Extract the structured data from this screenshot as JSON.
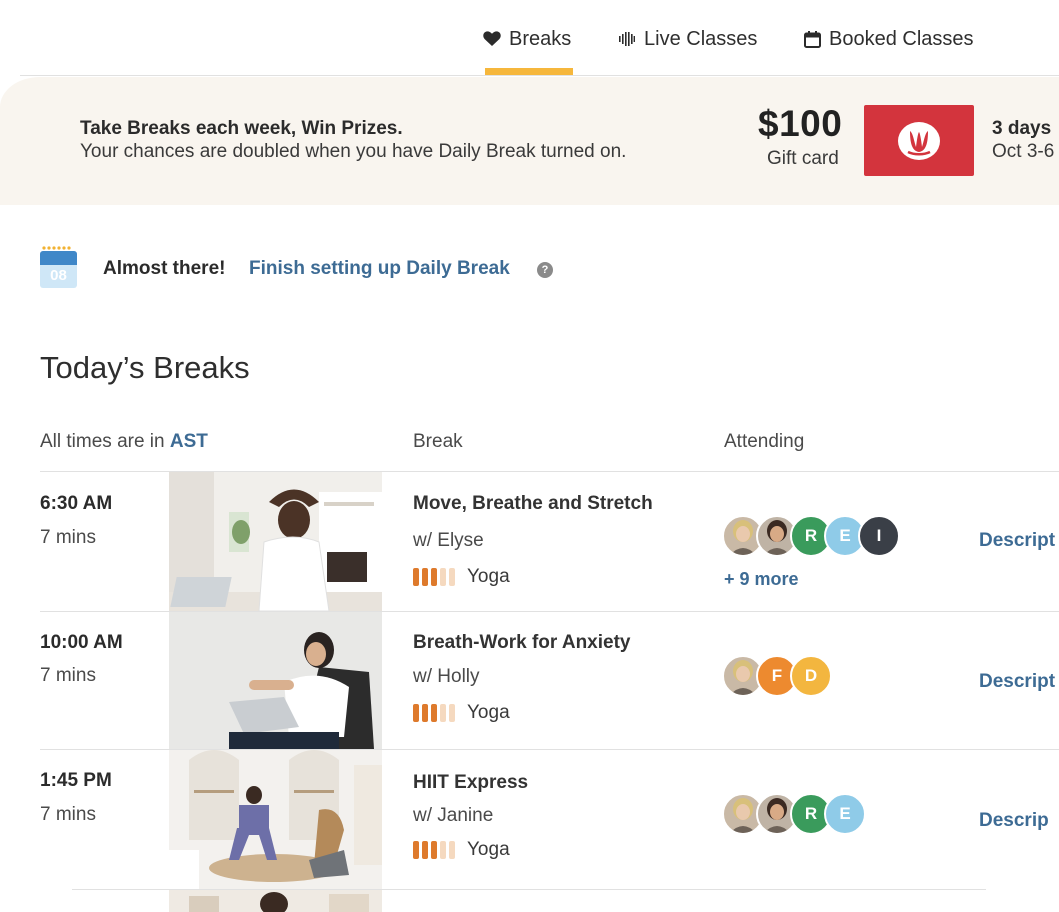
{
  "tabs": [
    {
      "label": "Breaks",
      "icon": "heart-icon",
      "active": true
    },
    {
      "label": "Live Classes",
      "icon": "live-bars-icon",
      "active": false
    },
    {
      "label": "Booked Classes",
      "icon": "calendar-icon",
      "active": false
    }
  ],
  "promo": {
    "title": "Take Breaks each week, Win Prizes.",
    "subtitle": "Your chances are doubled when you have Daily Break turned on.",
    "prize_amount": "$100",
    "prize_label": "Gift card",
    "brand_icon": "lululemon-logo",
    "days": "3 days",
    "dates": "Oct 3-6"
  },
  "setup": {
    "calendar_day": "08",
    "text": "Almost there!",
    "link": "Finish setting up Daily Break",
    "help": "?"
  },
  "section_title": "Today’s Breaks",
  "columns": {
    "time_prefix": "All times are in",
    "timezone": "AST",
    "break": "Break",
    "attending": "Attending"
  },
  "colors": {
    "accent": "#f6b73c",
    "link": "#3d6b94",
    "brand_red": "#d3343d",
    "banner_bg": "#f9f5ef",
    "intensity_on": "#de7a2c",
    "intensity_off": "#f5d9bf"
  },
  "breaks": [
    {
      "time": "6:30 AM",
      "duration": "7 mins",
      "title": "Move, Breathe and Stretch",
      "instructor": "w/ Elyse",
      "category": "Yoga",
      "intensity": 3,
      "attendees": [
        {
          "type": "photo",
          "label": ""
        },
        {
          "type": "photo",
          "label": ""
        },
        {
          "type": "initial",
          "label": "R",
          "color": "#3a9b5c"
        },
        {
          "type": "initial",
          "label": "E",
          "color": "#8fcbe8"
        },
        {
          "type": "initial",
          "label": "I",
          "color": "#3a3f47"
        }
      ],
      "more": "+ 9 more",
      "action": "Descript"
    },
    {
      "time": "10:00 AM",
      "duration": "7 mins",
      "title": "Breath-Work for Anxiety",
      "instructor": "w/ Holly",
      "category": "Yoga",
      "intensity": 3,
      "attendees": [
        {
          "type": "photo",
          "label": ""
        },
        {
          "type": "initial",
          "label": "F",
          "color": "#ed8a2f"
        },
        {
          "type": "initial",
          "label": "D",
          "color": "#f3b63f"
        }
      ],
      "more": "",
      "action": "Descript"
    },
    {
      "time": "1:45 PM",
      "duration": "7 mins",
      "title": "HIIT Express",
      "instructor": "w/ Janine",
      "category": "Yoga",
      "intensity": 3,
      "attendees": [
        {
          "type": "photo",
          "label": ""
        },
        {
          "type": "photo",
          "label": ""
        },
        {
          "type": "initial",
          "label": "R",
          "color": "#3a9b5c"
        },
        {
          "type": "initial",
          "label": "E",
          "color": "#8fcbe8"
        }
      ],
      "more": "",
      "action": "Descrip"
    }
  ]
}
